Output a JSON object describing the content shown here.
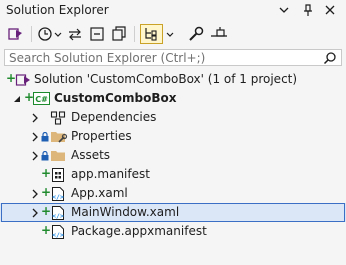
{
  "window": {
    "title": "Solution Explorer"
  },
  "search": {
    "placeholder": "Search Solution Explorer (Ctrl+;)"
  },
  "tree": {
    "solution_label": "Solution 'CustomComboBox' (1 of 1 project)",
    "project_label": "CustomComboBox",
    "items": [
      {
        "label": "Dependencies",
        "icon": "dependencies-icon"
      },
      {
        "label": "Properties",
        "icon": "folder-wrench-icon"
      },
      {
        "label": "Assets",
        "icon": "folder-icon"
      },
      {
        "label": "app.manifest",
        "icon": "manifest-icon"
      },
      {
        "label": "App.xaml",
        "icon": "xaml-icon"
      },
      {
        "label": "MainWindow.xaml",
        "icon": "xaml-icon"
      },
      {
        "label": "Package.appxmanifest",
        "icon": "xaml-icon"
      }
    ],
    "project_badge": "C#"
  },
  "colors": {
    "background": "#f5f5f5",
    "selected_row": "#dbe6f7",
    "selected_border": "#3b6ec5",
    "add_green": "#1f8a2e",
    "vs_purple": "#68217a",
    "folder_tan": "#dcb67a",
    "xaml_blue": "#1e88e5"
  }
}
